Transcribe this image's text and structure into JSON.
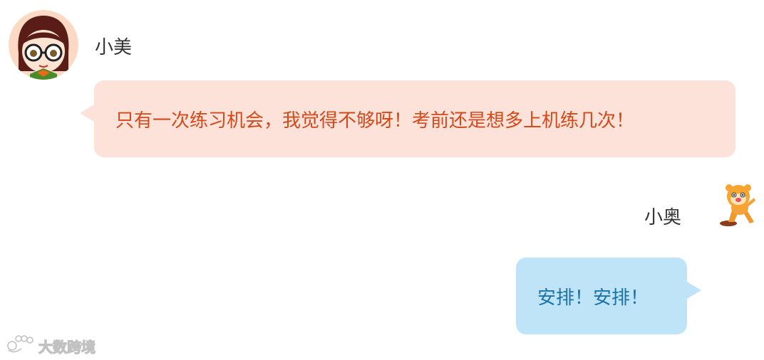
{
  "messages": [
    {
      "sender": "小美",
      "side": "left",
      "avatar_icon": "girl-with-glasses-avatar",
      "text": "只有一次练习机会，我觉得不够呀！考前还是想多上机练几次！",
      "bubble_color": "#fde2da",
      "text_color": "#d2491a"
    },
    {
      "sender": "小奥",
      "side": "right",
      "avatar_icon": "orange-mascot-avatar",
      "text": "安排！安排！",
      "bubble_color": "#bfe4f8",
      "text_color": "#1a73a8"
    }
  ],
  "watermark": {
    "icon": "paw-logo-icon",
    "text": "大数跨境"
  }
}
